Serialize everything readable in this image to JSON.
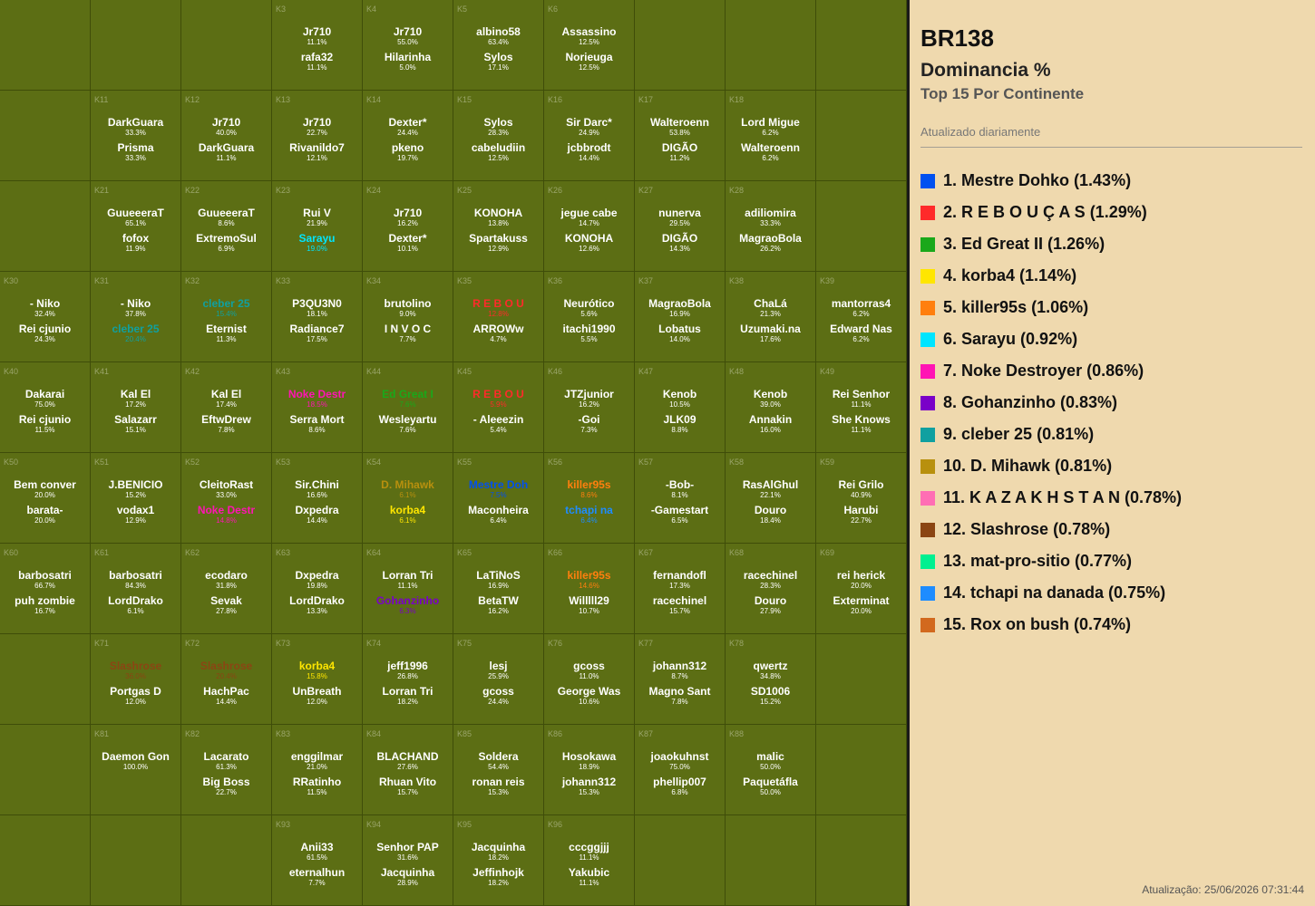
{
  "panel": {
    "world": "BR138",
    "subtitle": "Dominancia %",
    "subtitle2": "Top 15 Por Continente",
    "updated": "Atualizado diariamente",
    "footer": "Atualização: 25/06/2026 07:31:44"
  },
  "ranking": [
    {
      "label": "1. Mestre Dohko (1.43%)",
      "color": "#0050f0"
    },
    {
      "label": "2. R E B O U Ç A S (1.29%)",
      "color": "#ff2a2a"
    },
    {
      "label": "3. Ed Great II (1.26%)",
      "color": "#1aa81a"
    },
    {
      "label": "4. korba4 (1.14%)",
      "color": "#ffe600"
    },
    {
      "label": "5. killer95s (1.06%)",
      "color": "#ff7f0e"
    },
    {
      "label": "6. Sarayu (0.92%)",
      "color": "#00e5ff"
    },
    {
      "label": "7. Noke Destroyer (0.86%)",
      "color": "#ff14b4"
    },
    {
      "label": "8. Gohanzinho (0.83%)",
      "color": "#7a00c8"
    },
    {
      "label": "9. cleber 25 (0.81%)",
      "color": "#10a0a0"
    },
    {
      "label": "10. D. Mihawk (0.81%)",
      "color": "#b8900e"
    },
    {
      "label": "11. K A Z A K H S T A N (0.78%)",
      "color": "#ff6eb4"
    },
    {
      "label": "12. Slashrose (0.78%)",
      "color": "#8b4513"
    },
    {
      "label": "13. mat-pro-sitio (0.77%)",
      "color": "#00f090"
    },
    {
      "label": "14. tchapi na danada (0.75%)",
      "color": "#1e8cff"
    },
    {
      "label": "15. Rox on bush (0.74%)",
      "color": "#d2691e"
    }
  ],
  "cells": [
    {
      "r": 0,
      "c": 3,
      "k": "K3",
      "e": [
        {
          "n": "Jr710",
          "p": "11.1%"
        },
        {
          "n": "rafa32",
          "p": "11.1%"
        }
      ]
    },
    {
      "r": 0,
      "c": 4,
      "k": "K4",
      "e": [
        {
          "n": "Jr710",
          "p": "55.0%"
        },
        {
          "n": "Hilarinha",
          "p": "5.0%"
        }
      ]
    },
    {
      "r": 0,
      "c": 5,
      "k": "K5",
      "e": [
        {
          "n": "albino58",
          "p": "63.4%"
        },
        {
          "n": "Sylos",
          "p": "17.1%"
        }
      ]
    },
    {
      "r": 0,
      "c": 6,
      "k": "K6",
      "e": [
        {
          "n": "Assassino",
          "p": "12.5%"
        },
        {
          "n": "Norieuga",
          "p": "12.5%"
        }
      ]
    },
    {
      "r": 1,
      "c": 1,
      "k": "K11",
      "e": [
        {
          "n": "DarkGuara",
          "p": "33.3%"
        },
        {
          "n": "Prisma",
          "p": "33.3%"
        }
      ]
    },
    {
      "r": 1,
      "c": 2,
      "k": "K12",
      "e": [
        {
          "n": "Jr710",
          "p": "40.0%"
        },
        {
          "n": "DarkGuara",
          "p": "11.1%"
        }
      ]
    },
    {
      "r": 1,
      "c": 3,
      "k": "K13",
      "e": [
        {
          "n": "Jr710",
          "p": "22.7%"
        },
        {
          "n": "Rivanildo7",
          "p": "12.1%"
        }
      ]
    },
    {
      "r": 1,
      "c": 4,
      "k": "K14",
      "e": [
        {
          "n": "Dexter*",
          "p": "24.4%"
        },
        {
          "n": "pkeno",
          "p": "19.7%"
        }
      ]
    },
    {
      "r": 1,
      "c": 5,
      "k": "K15",
      "e": [
        {
          "n": "Sylos",
          "p": "28.3%"
        },
        {
          "n": "cabeludiin",
          "p": "12.5%"
        }
      ]
    },
    {
      "r": 1,
      "c": 6,
      "k": "K16",
      "e": [
        {
          "n": "Sir Darc*",
          "p": "24.9%"
        },
        {
          "n": "jcbbrodt",
          "p": "14.4%"
        }
      ]
    },
    {
      "r": 1,
      "c": 7,
      "k": "K17",
      "e": [
        {
          "n": "Walteroenn",
          "p": "53.8%"
        },
        {
          "n": "DIGÃO",
          "p": "11.2%"
        }
      ]
    },
    {
      "r": 1,
      "c": 8,
      "k": "K18",
      "e": [
        {
          "n": "Lord Migue",
          "p": "6.2%"
        },
        {
          "n": "Walteroenn",
          "p": "6.2%"
        }
      ]
    },
    {
      "r": 2,
      "c": 1,
      "k": "K21",
      "e": [
        {
          "n": "GuueeeraT",
          "p": "65.1%"
        },
        {
          "n": "fofox",
          "p": "11.9%"
        }
      ]
    },
    {
      "r": 2,
      "c": 2,
      "k": "K22",
      "e": [
        {
          "n": "GuueeeraT",
          "p": "8.6%"
        },
        {
          "n": "ExtremoSul",
          "p": "6.9%"
        }
      ]
    },
    {
      "r": 2,
      "c": 3,
      "k": "K23",
      "e": [
        {
          "n": "Rui V",
          "p": "21.9%"
        },
        {
          "n": "Sarayu",
          "p": "19.0%",
          "col": "#00e5ff"
        }
      ]
    },
    {
      "r": 2,
      "c": 4,
      "k": "K24",
      "e": [
        {
          "n": "Jr710",
          "p": "16.2%"
        },
        {
          "n": "Dexter*",
          "p": "10.1%"
        }
      ]
    },
    {
      "r": 2,
      "c": 5,
      "k": "K25",
      "e": [
        {
          "n": "KONOHA",
          "p": "13.8%"
        },
        {
          "n": "Spartakuss",
          "p": "12.9%"
        }
      ]
    },
    {
      "r": 2,
      "c": 6,
      "k": "K26",
      "e": [
        {
          "n": "jegue cabe",
          "p": "14.7%"
        },
        {
          "n": "KONOHA",
          "p": "12.6%"
        }
      ]
    },
    {
      "r": 2,
      "c": 7,
      "k": "K27",
      "e": [
        {
          "n": "nunerva",
          "p": "29.5%"
        },
        {
          "n": "DIGÃO",
          "p": "14.3%"
        }
      ]
    },
    {
      "r": 2,
      "c": 8,
      "k": "K28",
      "e": [
        {
          "n": "adiliomira",
          "p": "33.3%"
        },
        {
          "n": "MagraoBola",
          "p": "26.2%"
        }
      ]
    },
    {
      "r": 3,
      "c": 0,
      "k": "K30",
      "e": [
        {
          "n": "- Niko",
          "p": "32.4%"
        },
        {
          "n": "Rei cjunio",
          "p": "24.3%"
        }
      ]
    },
    {
      "r": 3,
      "c": 1,
      "k": "K31",
      "e": [
        {
          "n": "- Niko",
          "p": "37.8%"
        },
        {
          "n": "cleber 25",
          "p": "20.4%",
          "col": "#10a0a0"
        }
      ]
    },
    {
      "r": 3,
      "c": 2,
      "k": "K32",
      "e": [
        {
          "n": "cleber 25",
          "p": "15.4%",
          "col": "#10a0a0"
        },
        {
          "n": "Eternist",
          "p": "11.3%"
        }
      ]
    },
    {
      "r": 3,
      "c": 3,
      "k": "K33",
      "e": [
        {
          "n": "P3QU3N0",
          "p": "18.1%"
        },
        {
          "n": "Radiance7",
          "p": "17.5%"
        }
      ]
    },
    {
      "r": 3,
      "c": 4,
      "k": "K34",
      "e": [
        {
          "n": "brutolino",
          "p": "9.0%"
        },
        {
          "n": "I N V O C",
          "p": "7.7%"
        }
      ]
    },
    {
      "r": 3,
      "c": 5,
      "k": "K35",
      "e": [
        {
          "n": "R E B O U",
          "p": "12.8%",
          "col": "#ff2a2a"
        },
        {
          "n": "ARROWw",
          "p": "4.7%"
        }
      ]
    },
    {
      "r": 3,
      "c": 6,
      "k": "K36",
      "e": [
        {
          "n": "Neurótico",
          "p": "5.6%"
        },
        {
          "n": "itachi1990",
          "p": "5.5%"
        }
      ]
    },
    {
      "r": 3,
      "c": 7,
      "k": "K37",
      "e": [
        {
          "n": "MagraoBola",
          "p": "16.9%"
        },
        {
          "n": "Lobatus",
          "p": "14.0%"
        }
      ]
    },
    {
      "r": 3,
      "c": 8,
      "k": "K38",
      "e": [
        {
          "n": "ChaLá",
          "p": "21.3%"
        },
        {
          "n": "Uzumaki.na",
          "p": "17.6%"
        }
      ]
    },
    {
      "r": 3,
      "c": 9,
      "k": "K39",
      "e": [
        {
          "n": "mantorras4",
          "p": "6.2%"
        },
        {
          "n": "Edward Nas",
          "p": "6.2%"
        }
      ]
    },
    {
      "r": 4,
      "c": 0,
      "k": "K40",
      "e": [
        {
          "n": "Dakarai",
          "p": "75.0%"
        },
        {
          "n": "Rei cjunio",
          "p": "11.5%"
        }
      ]
    },
    {
      "r": 4,
      "c": 1,
      "k": "K41",
      "e": [
        {
          "n": "Kal El",
          "p": "17.2%"
        },
        {
          "n": "Salazarr",
          "p": "15.1%"
        }
      ]
    },
    {
      "r": 4,
      "c": 2,
      "k": "K42",
      "e": [
        {
          "n": "Kal El",
          "p": "17.4%"
        },
        {
          "n": "EftwDrew",
          "p": "7.8%"
        }
      ]
    },
    {
      "r": 4,
      "c": 3,
      "k": "K43",
      "e": [
        {
          "n": "Noke Destr",
          "p": "18.5%",
          "col": "#ff14b4"
        },
        {
          "n": "Serra Mort",
          "p": "8.6%"
        }
      ]
    },
    {
      "r": 4,
      "c": 4,
      "k": "K44",
      "e": [
        {
          "n": "Ed Great I",
          "p": "7.6%",
          "col": "#1aa81a"
        },
        {
          "n": "Wesleyartu",
          "p": "7.6%"
        }
      ]
    },
    {
      "r": 4,
      "c": 5,
      "k": "K45",
      "e": [
        {
          "n": "R E B O U",
          "p": "5.9%",
          "col": "#ff2a2a"
        },
        {
          "n": "- Aleeezin",
          "p": "5.4%"
        }
      ]
    },
    {
      "r": 4,
      "c": 6,
      "k": "K46",
      "e": [
        {
          "n": "JTZjunior",
          "p": "16.2%"
        },
        {
          "n": "-Goi",
          "p": "7.3%"
        }
      ]
    },
    {
      "r": 4,
      "c": 7,
      "k": "K47",
      "e": [
        {
          "n": "Kenob",
          "p": "10.5%"
        },
        {
          "n": "JLK09",
          "p": "8.8%"
        }
      ]
    },
    {
      "r": 4,
      "c": 8,
      "k": "K48",
      "e": [
        {
          "n": "Kenob",
          "p": "39.0%"
        },
        {
          "n": "Annakin",
          "p": "16.0%"
        }
      ]
    },
    {
      "r": 4,
      "c": 9,
      "k": "K49",
      "e": [
        {
          "n": "Rei Senhor",
          "p": "11.1%"
        },
        {
          "n": "She Knows",
          "p": "11.1%"
        }
      ]
    },
    {
      "r": 5,
      "c": 0,
      "k": "K50",
      "e": [
        {
          "n": "Bem conver",
          "p": "20.0%"
        },
        {
          "n": "barata-",
          "p": "20.0%"
        }
      ]
    },
    {
      "r": 5,
      "c": 1,
      "k": "K51",
      "e": [
        {
          "n": "J.BENICIO",
          "p": "15.2%"
        },
        {
          "n": "vodax1",
          "p": "12.9%"
        }
      ]
    },
    {
      "r": 5,
      "c": 2,
      "k": "K52",
      "e": [
        {
          "n": "CleitoRast",
          "p": "33.0%"
        },
        {
          "n": "Noke Destr",
          "p": "14.8%",
          "col": "#ff14b4"
        }
      ]
    },
    {
      "r": 5,
      "c": 3,
      "k": "K53",
      "e": [
        {
          "n": "Sir.Chini",
          "p": "16.6%"
        },
        {
          "n": "Dxpedra",
          "p": "14.4%"
        }
      ]
    },
    {
      "r": 5,
      "c": 4,
      "k": "K54",
      "e": [
        {
          "n": "D. Mihawk",
          "p": "6.1%",
          "col": "#b8900e"
        },
        {
          "n": "korba4",
          "p": "6.1%",
          "col": "#ffe600"
        }
      ]
    },
    {
      "r": 5,
      "c": 5,
      "k": "K55",
      "e": [
        {
          "n": "Mestre Doh",
          "p": "7.5%",
          "col": "#0050f0"
        },
        {
          "n": "Maconheira",
          "p": "6.4%"
        }
      ]
    },
    {
      "r": 5,
      "c": 6,
      "k": "K56",
      "e": [
        {
          "n": "killer95s",
          "p": "8.6%",
          "col": "#ff7f0e"
        },
        {
          "n": "tchapi na",
          "p": "6.4%",
          "col": "#1e8cff"
        }
      ]
    },
    {
      "r": 5,
      "c": 7,
      "k": "K57",
      "e": [
        {
          "n": "-Bob-",
          "p": "8.1%"
        },
        {
          "n": "-Gamestart",
          "p": "6.5%"
        }
      ]
    },
    {
      "r": 5,
      "c": 8,
      "k": "K58",
      "e": [
        {
          "n": "RasAlGhul",
          "p": "22.1%"
        },
        {
          "n": "Douro",
          "p": "18.4%"
        }
      ]
    },
    {
      "r": 5,
      "c": 9,
      "k": "K59",
      "e": [
        {
          "n": "Rei Grilo",
          "p": "40.9%"
        },
        {
          "n": "Harubi",
          "p": "22.7%"
        }
      ]
    },
    {
      "r": 6,
      "c": 0,
      "k": "K60",
      "e": [
        {
          "n": "barbosatri",
          "p": "66.7%"
        },
        {
          "n": "puh zombie",
          "p": "16.7%"
        }
      ]
    },
    {
      "r": 6,
      "c": 1,
      "k": "K61",
      "e": [
        {
          "n": "barbosatri",
          "p": "84.3%"
        },
        {
          "n": "LordDrako",
          "p": "6.1%"
        }
      ]
    },
    {
      "r": 6,
      "c": 2,
      "k": "K62",
      "e": [
        {
          "n": "ecodaro",
          "p": "31.8%"
        },
        {
          "n": "Sevak",
          "p": "27.8%"
        }
      ]
    },
    {
      "r": 6,
      "c": 3,
      "k": "K63",
      "e": [
        {
          "n": "Dxpedra",
          "p": "19.8%"
        },
        {
          "n": "LordDrako",
          "p": "13.3%"
        }
      ]
    },
    {
      "r": 6,
      "c": 4,
      "k": "K64",
      "e": [
        {
          "n": "Lorran Tri",
          "p": "11.1%"
        },
        {
          "n": "Gohanzinho",
          "p": "6.3%",
          "col": "#7a00c8"
        }
      ]
    },
    {
      "r": 6,
      "c": 5,
      "k": "K65",
      "e": [
        {
          "n": "LaTiNoS",
          "p": "16.9%"
        },
        {
          "n": "BetaTW",
          "p": "16.2%"
        }
      ]
    },
    {
      "r": 6,
      "c": 6,
      "k": "K66",
      "e": [
        {
          "n": "killer95s",
          "p": "14.6%",
          "col": "#ff7f0e"
        },
        {
          "n": "Willlll29",
          "p": "10.7%"
        }
      ]
    },
    {
      "r": 6,
      "c": 7,
      "k": "K67",
      "e": [
        {
          "n": "fernandofl",
          "p": "17.3%"
        },
        {
          "n": "racechinel",
          "p": "15.7%"
        }
      ]
    },
    {
      "r": 6,
      "c": 8,
      "k": "K68",
      "e": [
        {
          "n": "racechinel",
          "p": "28.3%"
        },
        {
          "n": "Douro",
          "p": "27.9%"
        }
      ]
    },
    {
      "r": 6,
      "c": 9,
      "k": "K69",
      "e": [
        {
          "n": "rei herick",
          "p": "20.0%"
        },
        {
          "n": "Exterminat",
          "p": "20.0%"
        }
      ]
    },
    {
      "r": 7,
      "c": 1,
      "k": "K71",
      "e": [
        {
          "n": "Slashrose",
          "p": "36.0%",
          "col": "#8b4513"
        },
        {
          "n": "Portgas D",
          "p": "12.0%"
        }
      ]
    },
    {
      "r": 7,
      "c": 2,
      "k": "K72",
      "e": [
        {
          "n": "Slashrose",
          "p": "20.4%",
          "col": "#8b4513"
        },
        {
          "n": "HachPac",
          "p": "14.4%"
        }
      ]
    },
    {
      "r": 7,
      "c": 3,
      "k": "K73",
      "e": [
        {
          "n": "korba4",
          "p": "15.8%",
          "col": "#ffe600"
        },
        {
          "n": "UnBreath",
          "p": "12.0%"
        }
      ]
    },
    {
      "r": 7,
      "c": 4,
      "k": "K74",
      "e": [
        {
          "n": "jeff1996",
          "p": "26.8%"
        },
        {
          "n": "Lorran Tri",
          "p": "18.2%"
        }
      ]
    },
    {
      "r": 7,
      "c": 5,
      "k": "K75",
      "e": [
        {
          "n": "lesj",
          "p": "25.9%"
        },
        {
          "n": "gcoss",
          "p": "24.4%"
        }
      ]
    },
    {
      "r": 7,
      "c": 6,
      "k": "K76",
      "e": [
        {
          "n": "gcoss",
          "p": "11.0%"
        },
        {
          "n": "George Was",
          "p": "10.6%"
        }
      ]
    },
    {
      "r": 7,
      "c": 7,
      "k": "K77",
      "e": [
        {
          "n": "johann312",
          "p": "8.7%"
        },
        {
          "n": "Magno Sant",
          "p": "7.8%"
        }
      ]
    },
    {
      "r": 7,
      "c": 8,
      "k": "K78",
      "e": [
        {
          "n": "qwertz",
          "p": "34.8%"
        },
        {
          "n": "SD1006",
          "p": "15.2%"
        }
      ]
    },
    {
      "r": 8,
      "c": 1,
      "k": "K81",
      "e": [
        {
          "n": "Daemon Gon",
          "p": "100.0%"
        }
      ]
    },
    {
      "r": 8,
      "c": 2,
      "k": "K82",
      "e": [
        {
          "n": "Lacarato",
          "p": "61.3%"
        },
        {
          "n": "Big Boss",
          "p": "22.7%"
        }
      ]
    },
    {
      "r": 8,
      "c": 3,
      "k": "K83",
      "e": [
        {
          "n": "enggilmar",
          "p": "21.0%"
        },
        {
          "n": "RRatinho",
          "p": "11.5%"
        }
      ]
    },
    {
      "r": 8,
      "c": 4,
      "k": "K84",
      "e": [
        {
          "n": "BLACHAND",
          "p": "27.6%"
        },
        {
          "n": "Rhuan Vito",
          "p": "15.7%"
        }
      ]
    },
    {
      "r": 8,
      "c": 5,
      "k": "K85",
      "e": [
        {
          "n": "Soldera",
          "p": "54.4%"
        },
        {
          "n": "ronan reis",
          "p": "15.3%"
        }
      ]
    },
    {
      "r": 8,
      "c": 6,
      "k": "K86",
      "e": [
        {
          "n": "Hosokawa",
          "p": "18.9%"
        },
        {
          "n": "johann312",
          "p": "15.3%"
        }
      ]
    },
    {
      "r": 8,
      "c": 7,
      "k": "K87",
      "e": [
        {
          "n": "joaokuhnst",
          "p": "75.0%"
        },
        {
          "n": "phellip007",
          "p": "6.8%"
        }
      ]
    },
    {
      "r": 8,
      "c": 8,
      "k": "K88",
      "e": [
        {
          "n": "malic",
          "p": "50.0%"
        },
        {
          "n": "Paquetáfla",
          "p": "50.0%"
        }
      ]
    },
    {
      "r": 9,
      "c": 3,
      "k": "K93",
      "e": [
        {
          "n": "Anii33",
          "p": "61.5%"
        },
        {
          "n": "eternalhun",
          "p": "7.7%"
        }
      ]
    },
    {
      "r": 9,
      "c": 4,
      "k": "K94",
      "e": [
        {
          "n": "Senhor PAP",
          "p": "31.6%"
        },
        {
          "n": "Jacquinha",
          "p": "28.9%"
        }
      ]
    },
    {
      "r": 9,
      "c": 5,
      "k": "K95",
      "e": [
        {
          "n": "Jacquinha",
          "p": "18.2%"
        },
        {
          "n": "Jeffinhojk",
          "p": "18.2%"
        }
      ]
    },
    {
      "r": 9,
      "c": 6,
      "k": "K96",
      "e": [
        {
          "n": "cccggjjj",
          "p": "11.1%"
        },
        {
          "n": "Yakubic",
          "p": "11.1%"
        }
      ]
    }
  ]
}
